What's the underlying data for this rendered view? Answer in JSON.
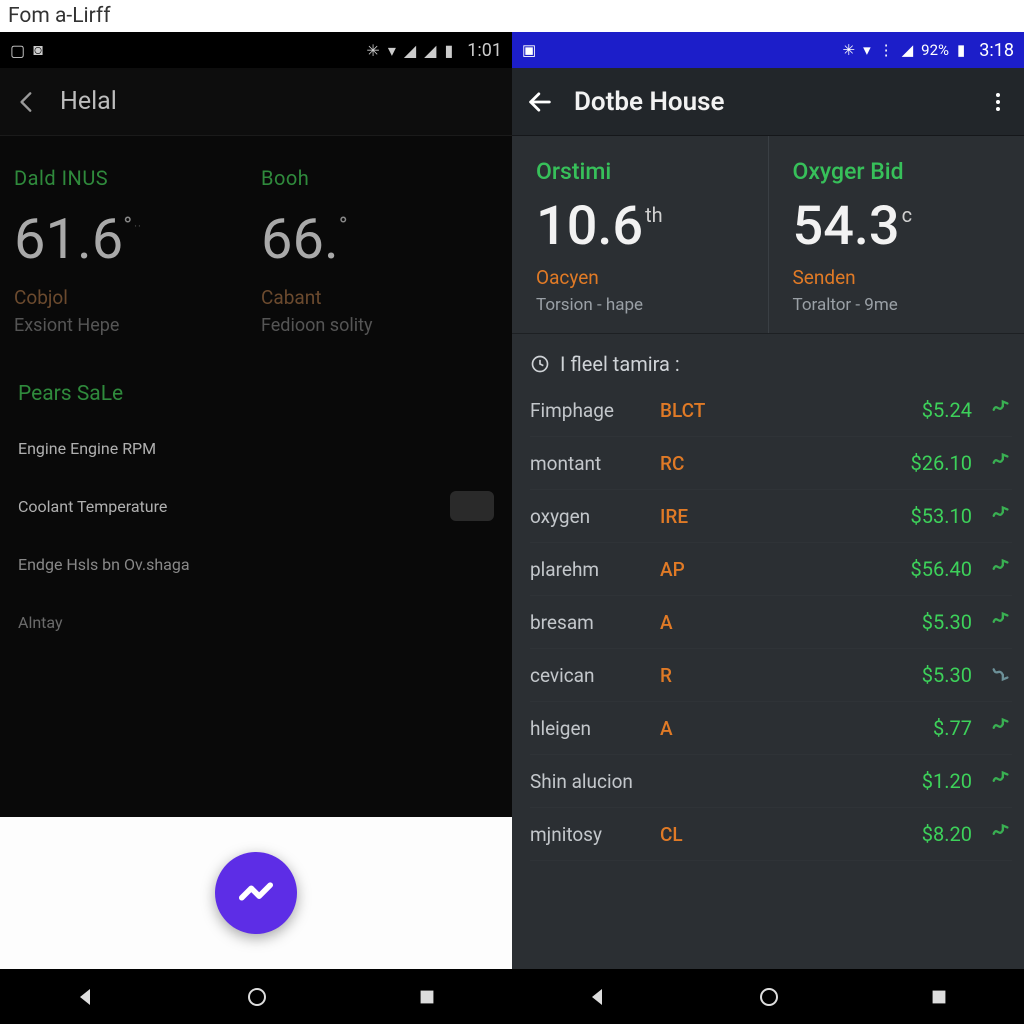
{
  "outer_caption": "Fom a-Lirff",
  "left": {
    "statusbar": {
      "time": "1:01"
    },
    "appbar": {
      "title": "Helal"
    },
    "gauges": [
      {
        "label": "Dald INUS",
        "value": "61.6",
        "unit": "°",
        "tiny": "··",
        "sub1": "Cobjol",
        "sub2": "Exsiont Hepe"
      },
      {
        "label": "Booh",
        "value": "66.",
        "unit": "°",
        "tiny": "",
        "sub1": "Cabant",
        "sub2": "Fedioon solity"
      }
    ],
    "section_title": "Pears SaLe",
    "rows": [
      {
        "text": "Engine  Engine  RPM"
      },
      {
        "text": "Coolant  Temperature"
      },
      {
        "text": "Endge Hsls bn Ov.shaga"
      },
      {
        "text": "Alntay"
      }
    ]
  },
  "right": {
    "statusbar": {
      "pct": "92%",
      "time": "3:18"
    },
    "appbar": {
      "title": "Dotbe House"
    },
    "gauges": [
      {
        "label": "Orstimi",
        "value": "10.6",
        "unit": "th",
        "sub1": "Oacyen",
        "sub2": "Torsion - hape"
      },
      {
        "label": "Oxyger Bid",
        "value": "54.3",
        "unit": "c",
        "sub1": "Senden",
        "sub2": "Toraltor - 9me"
      }
    ],
    "section_title": "I fleel tamira :",
    "rows": [
      {
        "name": "Fimphage",
        "code": "BLCT",
        "price": "$5.24",
        "dir": "up"
      },
      {
        "name": "montant",
        "code": "RC",
        "price": "$26.10",
        "dir": "up"
      },
      {
        "name": "oxygen",
        "code": "IRE",
        "price": "$53.10",
        "dir": "up"
      },
      {
        "name": "plarehm",
        "code": "AP",
        "price": "$56.40",
        "dir": "up"
      },
      {
        "name": "bresam",
        "code": "A",
        "price": "$5.30",
        "dir": "up"
      },
      {
        "name": "cevican",
        "code": "R",
        "price": "$5.30",
        "dir": "down"
      },
      {
        "name": "hleigen",
        "code": "A",
        "price": "$.77",
        "dir": "up"
      },
      {
        "name": "Shin alucion",
        "code": "",
        "price": "$1.20",
        "dir": "up"
      },
      {
        "name": "mjnitosy",
        "code": "CL",
        "price": "$8.20",
        "dir": "up"
      }
    ]
  }
}
